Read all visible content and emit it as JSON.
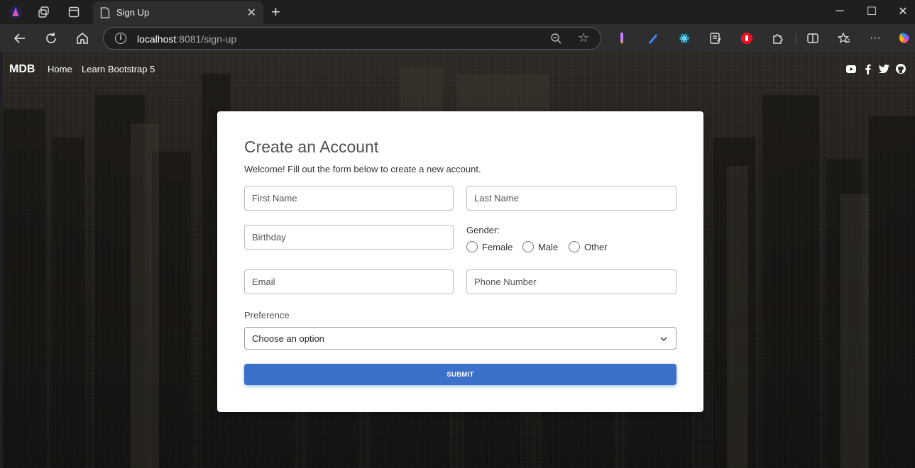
{
  "browser": {
    "tab_title": "Sign Up",
    "url_host": "localhost",
    "url_rest": ":8081/sign-up",
    "window_controls": {
      "minimize": "─",
      "maximize": "☐",
      "close": "✕"
    },
    "icons": [
      "profile-icon",
      "workspaces-icon",
      "tab-actions-icon",
      "page-icon",
      "close-tab-icon",
      "new-tab-icon",
      "back-icon",
      "refresh-icon",
      "home-icon",
      "site-info-icon",
      "zoom-out-icon",
      "favorite-star-icon",
      "extension-icons",
      "split-screen-icon",
      "favorites-icon",
      "more-icon",
      "copilot-icon"
    ]
  },
  "page": {
    "brand": "MDB",
    "nav_links": [
      "Home",
      "Learn Bootstrap 5"
    ],
    "social_icons": [
      "youtube-icon",
      "facebook-icon",
      "twitter-icon",
      "github-icon"
    ]
  },
  "form": {
    "title": "Create an Account",
    "subtitle": "Welcome! Fill out the form below to create a new account.",
    "first_name": {
      "placeholder": "First Name",
      "value": ""
    },
    "last_name": {
      "placeholder": "Last Name",
      "value": ""
    },
    "birthday": {
      "placeholder": "Birthday",
      "value": ""
    },
    "gender_label": "Gender:",
    "gender_options": [
      "Female",
      "Male",
      "Other"
    ],
    "email": {
      "placeholder": "Email",
      "value": ""
    },
    "phone": {
      "placeholder": "Phone Number",
      "value": ""
    },
    "preference_label": "Preference",
    "preference_selected": "Choose an option",
    "submit_label": "SUBMIT",
    "colors": {
      "primary": "#3b71ca",
      "card": "#ffffff",
      "title": "#4f4f4f"
    }
  }
}
